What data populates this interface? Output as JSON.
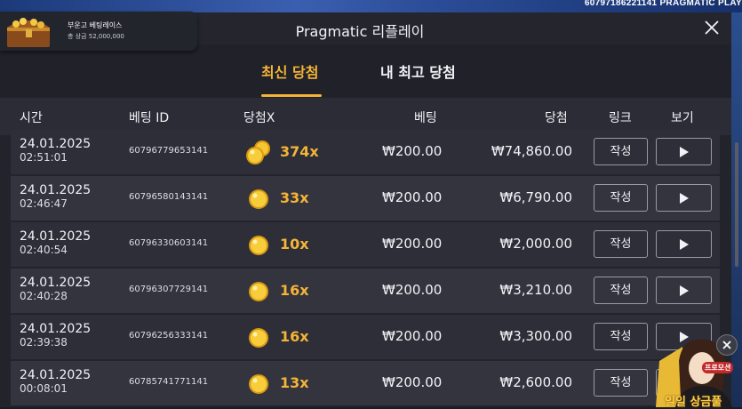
{
  "background": {
    "game_id_text": "60797186221141   PRAGMATIC PLAY"
  },
  "promo_banner": {
    "title": "부운고 베팅레이스",
    "subtitle": "총 상금 52,000,000"
  },
  "modal": {
    "title": "Pragmatic 리플레이",
    "tabs": [
      {
        "label": "최신 당첨",
        "active": true
      },
      {
        "label": "내 최고 당첨",
        "active": false
      }
    ],
    "columns": {
      "time": "시간",
      "bet_id": "베팅 ID",
      "multiplier": "당첨X",
      "bet": "베팅",
      "win": "당첨",
      "link": "링크",
      "view": "보기"
    },
    "rows": [
      {
        "date": "24.01.2025",
        "time": "02:51:01",
        "bet_id": "60796779653141",
        "multiplier": "374x",
        "bet": "₩200.00",
        "win": "₩74,860.00",
        "link_label": "작성",
        "coins": 2
      },
      {
        "date": "24.01.2025",
        "time": "02:46:47",
        "bet_id": "60796580143141",
        "multiplier": "33x",
        "bet": "₩200.00",
        "win": "₩6,790.00",
        "link_label": "작성",
        "coins": 1
      },
      {
        "date": "24.01.2025",
        "time": "02:40:54",
        "bet_id": "60796330603141",
        "multiplier": "10x",
        "bet": "₩200.00",
        "win": "₩2,000.00",
        "link_label": "작성",
        "coins": 1
      },
      {
        "date": "24.01.2025",
        "time": "02:40:28",
        "bet_id": "60796307729141",
        "multiplier": "16x",
        "bet": "₩200.00",
        "win": "₩3,210.00",
        "link_label": "작성",
        "coins": 1
      },
      {
        "date": "24.01.2025",
        "time": "02:39:38",
        "bet_id": "60796256333141",
        "multiplier": "16x",
        "bet": "₩200.00",
        "win": "₩3,300.00",
        "link_label": "작성",
        "coins": 1
      },
      {
        "date": "24.01.2025",
        "time": "00:08:01",
        "bet_id": "60785741771141",
        "multiplier": "13x",
        "bet": "₩200.00",
        "win": "₩2,600.00",
        "link_label": "작성",
        "coins": 1
      }
    ]
  },
  "promo_widget": {
    "badge": "프로모션",
    "label": "일일 상금풀"
  },
  "colors": {
    "accent": "#f4b437",
    "panel": "#22232b",
    "row_odd": "#2d2e37",
    "row_even": "#33343e"
  },
  "icons": {
    "close": "close-icon",
    "play": "play-icon",
    "coin": "coin-icon",
    "chest": "treasure-chest-icon"
  }
}
